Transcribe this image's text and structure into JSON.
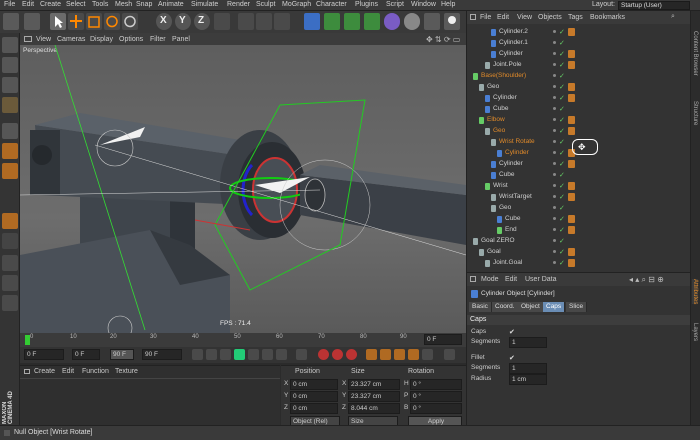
{
  "menubar": {
    "items": [
      "File",
      "Edit",
      "Create",
      "Select",
      "Tools",
      "Mesh",
      "Snap",
      "Animate",
      "Simulate",
      "Render",
      "Sculpt",
      "MoGraph",
      "Character",
      "Plugins",
      "Script",
      "Window",
      "Help"
    ],
    "layout_label": "Layout:",
    "layout_value": "Startup (User)"
  },
  "viewport": {
    "menu": [
      "View",
      "Cameras",
      "Display",
      "Options",
      "Filter",
      "Panel"
    ],
    "label": "Perspective",
    "fps": "FPS : 71.4"
  },
  "timeline": {
    "ticks": [
      "0",
      "10",
      "20",
      "30",
      "40",
      "50",
      "60",
      "70",
      "80",
      "90"
    ],
    "end_label": "0 F"
  },
  "playbar": {
    "current_frame": "0 F",
    "range_start": "0 F",
    "range_end": "90 F",
    "max_frame": "90 F"
  },
  "material_manager": {
    "menu": [
      "Create",
      "Edit",
      "Function",
      "Texture"
    ]
  },
  "coordinates": {
    "headers": [
      "Position",
      "Size",
      "Rotation"
    ],
    "rows": [
      {
        "axis": "X",
        "pos": "0 cm",
        "size_axis": "X",
        "size": "23.327 cm",
        "rot_axis": "H",
        "rot": "0 °"
      },
      {
        "axis": "Y",
        "pos": "0 cm",
        "size_axis": "Y",
        "size": "23.327 cm",
        "rot_axis": "P",
        "rot": "0 °"
      },
      {
        "axis": "Z",
        "pos": "0 cm",
        "size_axis": "Z",
        "size": "8.044 cm",
        "rot_axis": "B",
        "rot": "0 °"
      }
    ],
    "mode_select": "Object (Rel)",
    "size_select": "Size",
    "apply_label": "Apply"
  },
  "object_manager": {
    "menu": [
      "File",
      "Edit",
      "View",
      "Objects",
      "Tags",
      "Bookmarks"
    ],
    "rows": [
      {
        "label": "Cylinder.2",
        "indent": 3,
        "color": "#4a7fd4",
        "highlight": false
      },
      {
        "label": "Cylinder.1",
        "indent": 3,
        "color": "#4a7fd4",
        "highlight": false
      },
      {
        "label": "Cylinder",
        "indent": 3,
        "color": "#4a7fd4",
        "highlight": false
      },
      {
        "label": "Joint.Pole",
        "indent": 2,
        "color": "#9aa",
        "highlight": false
      },
      {
        "label": "Base(Shoulder)",
        "indent": 0,
        "color": "#6c6",
        "highlight": true
      },
      {
        "label": "Geo",
        "indent": 1,
        "color": "#9aa",
        "highlight": false
      },
      {
        "label": "Cylinder",
        "indent": 2,
        "color": "#4a7fd4",
        "highlight": false
      },
      {
        "label": "Cube",
        "indent": 2,
        "color": "#4a7fd4",
        "highlight": false
      },
      {
        "label": "Elbow",
        "indent": 1,
        "color": "#6c6",
        "highlight": true
      },
      {
        "label": "Geo",
        "indent": 2,
        "color": "#9aa",
        "highlight": true
      },
      {
        "label": "Wrist Rotate",
        "indent": 3,
        "color": "#9aa",
        "highlight": true
      },
      {
        "label": "Cylinder",
        "indent": 4,
        "color": "#4a7fd4",
        "highlight": true
      },
      {
        "label": "Cylinder",
        "indent": 3,
        "color": "#4a7fd4",
        "highlight": false
      },
      {
        "label": "Cube",
        "indent": 3,
        "color": "#4a7fd4",
        "highlight": false
      },
      {
        "label": "Wrist",
        "indent": 2,
        "color": "#6c6",
        "highlight": false
      },
      {
        "label": "WristTarget",
        "indent": 3,
        "color": "#9aa",
        "highlight": false
      },
      {
        "label": "Geo",
        "indent": 3,
        "color": "#9aa",
        "highlight": false
      },
      {
        "label": "Cube",
        "indent": 4,
        "color": "#4a7fd4",
        "highlight": false
      },
      {
        "label": "End",
        "indent": 4,
        "color": "#6c6",
        "highlight": false
      },
      {
        "label": "Goal ZERO",
        "indent": 0,
        "color": "#9aa",
        "highlight": false
      },
      {
        "label": "Goal",
        "indent": 1,
        "color": "#9aa",
        "highlight": false
      },
      {
        "label": "Joint.Goal",
        "indent": 2,
        "color": "#9aa",
        "highlight": false
      }
    ]
  },
  "attribute_manager": {
    "menu": [
      "Mode",
      "Edit",
      "User Data"
    ],
    "object_title": "Cylinder Object [Cylinder]",
    "tabs": [
      "Basic",
      "Coord.",
      "Object",
      "Caps",
      "Slice"
    ],
    "active_tab": "Caps",
    "section": "Caps",
    "fields": [
      {
        "label": "Caps",
        "value": "✔"
      },
      {
        "label": "Segments",
        "value": "1"
      },
      {
        "label": "Fillet",
        "value": "✔"
      },
      {
        "label": "Segments",
        "value": "1"
      },
      {
        "label": "Radius",
        "value": "1 cm"
      }
    ]
  },
  "side_tabs": [
    "Content Browser",
    "Structure",
    "Attributes",
    "Layers"
  ],
  "logo_text": "MAXON CINEMA 4D",
  "statusbar": {
    "text": "Null Object [Wrist Rotate]"
  },
  "colors": {
    "accent": "#6a8db5",
    "highlight_text": "#e08a2a",
    "ui_bg": "#333333"
  }
}
